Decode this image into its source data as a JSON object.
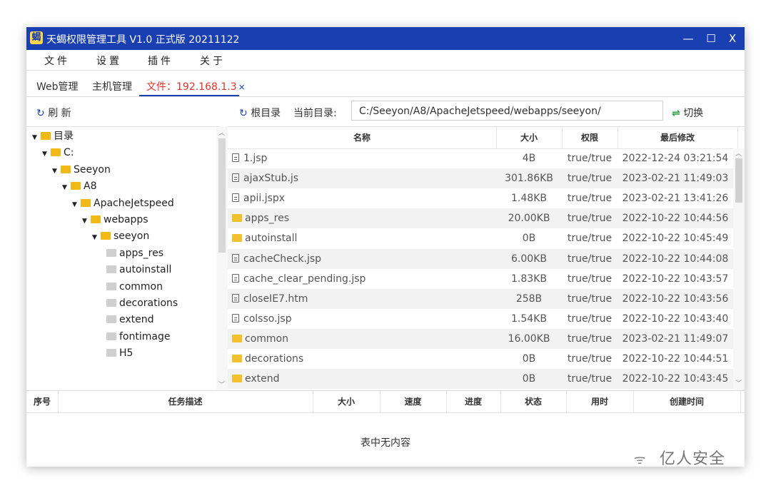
{
  "window": {
    "title": "天蝎权限管理工具 V1.0 正式版 20211122",
    "controls": {
      "minimize": "—",
      "maximize": "☐",
      "close": "X"
    }
  },
  "menu": [
    "文件",
    "设置",
    "插件",
    "关于"
  ],
  "tabs": [
    {
      "label": "Web管理",
      "active": false
    },
    {
      "label": "主机管理",
      "active": false
    },
    {
      "label": "文件：192.168.1.3",
      "active": true,
      "close": "×"
    }
  ],
  "left_toolbar": {
    "refresh_icon": "↻",
    "refresh_label": "刷 新"
  },
  "tree": [
    {
      "label": "目录",
      "level": 0,
      "expanded": true
    },
    {
      "label": "C:",
      "level": 1,
      "expanded": true
    },
    {
      "label": "Seeyon",
      "level": 2,
      "expanded": true
    },
    {
      "label": "A8",
      "level": 3,
      "expanded": true
    },
    {
      "label": "ApacheJetspeed",
      "level": 4,
      "expanded": true
    },
    {
      "label": "webapps",
      "level": 5,
      "expanded": true
    },
    {
      "label": "seeyon",
      "level": 6,
      "expanded": true
    },
    {
      "label": "apps_res",
      "level": 7,
      "expanded": false
    },
    {
      "label": "autoinstall",
      "level": 7,
      "expanded": false
    },
    {
      "label": "common",
      "level": 7,
      "expanded": false
    },
    {
      "label": "decorations",
      "level": 7,
      "expanded": false
    },
    {
      "label": "extend",
      "level": 7,
      "expanded": false
    },
    {
      "label": "fontimage",
      "level": 7,
      "expanded": false
    },
    {
      "label": "H5",
      "level": 7,
      "expanded": false
    }
  ],
  "right_toolbar": {
    "root_icon": "↻",
    "root_label": "根目录",
    "current_dir_label": "当前目录:",
    "path": "C:/Seeyon/A8/ApacheJetspeed/webapps/seeyon/",
    "switch_icon": "⇌",
    "switch_label": "切换"
  },
  "file_table": {
    "columns": [
      "名称",
      "大小",
      "权限",
      "最后修改"
    ],
    "rows": [
      {
        "type": "file",
        "name": "1.jsp",
        "size": "4B",
        "perm": "true/true",
        "modified": "2022-12-24 03:21:54"
      },
      {
        "type": "file",
        "name": "ajaxStub.js",
        "size": "301.86KB",
        "perm": "true/true",
        "modified": "2023-02-21 11:49:03"
      },
      {
        "type": "file",
        "name": "apii.jspx",
        "size": "1.48KB",
        "perm": "true/true",
        "modified": "2023-02-21 13:41:26"
      },
      {
        "type": "folder",
        "name": "apps_res",
        "size": "20.00KB",
        "perm": "true/true",
        "modified": "2022-10-22 10:44:56"
      },
      {
        "type": "folder",
        "name": "autoinstall",
        "size": "0B",
        "perm": "true/true",
        "modified": "2022-10-22 10:45:49"
      },
      {
        "type": "file",
        "name": "cacheCheck.jsp",
        "size": "6.00KB",
        "perm": "true/true",
        "modified": "2022-10-22 10:44:08"
      },
      {
        "type": "file",
        "name": "cache_clear_pending.jsp",
        "size": "1.83KB",
        "perm": "true/true",
        "modified": "2022-10-22 10:43:57"
      },
      {
        "type": "file",
        "name": "closeIE7.htm",
        "size": "258B",
        "perm": "true/true",
        "modified": "2022-10-22 10:43:56"
      },
      {
        "type": "file",
        "name": "colsso.jsp",
        "size": "1.54KB",
        "perm": "true/true",
        "modified": "2022-10-22 10:43:40"
      },
      {
        "type": "folder",
        "name": "common",
        "size": "16.00KB",
        "perm": "true/true",
        "modified": "2023-02-21 11:49:07"
      },
      {
        "type": "folder",
        "name": "decorations",
        "size": "0B",
        "perm": "true/true",
        "modified": "2022-10-22 10:44:51"
      },
      {
        "type": "folder",
        "name": "extend",
        "size": "0B",
        "perm": "true/true",
        "modified": "2022-10-22 10:43:45"
      }
    ]
  },
  "task_table": {
    "columns": [
      "序号",
      "任务描述",
      "大小",
      "速度",
      "进度",
      "状态",
      "用时",
      "创建时间"
    ],
    "empty_message": "表中无内容"
  },
  "watermark": {
    "icon": "ᯤ",
    "text": "亿人安全"
  }
}
